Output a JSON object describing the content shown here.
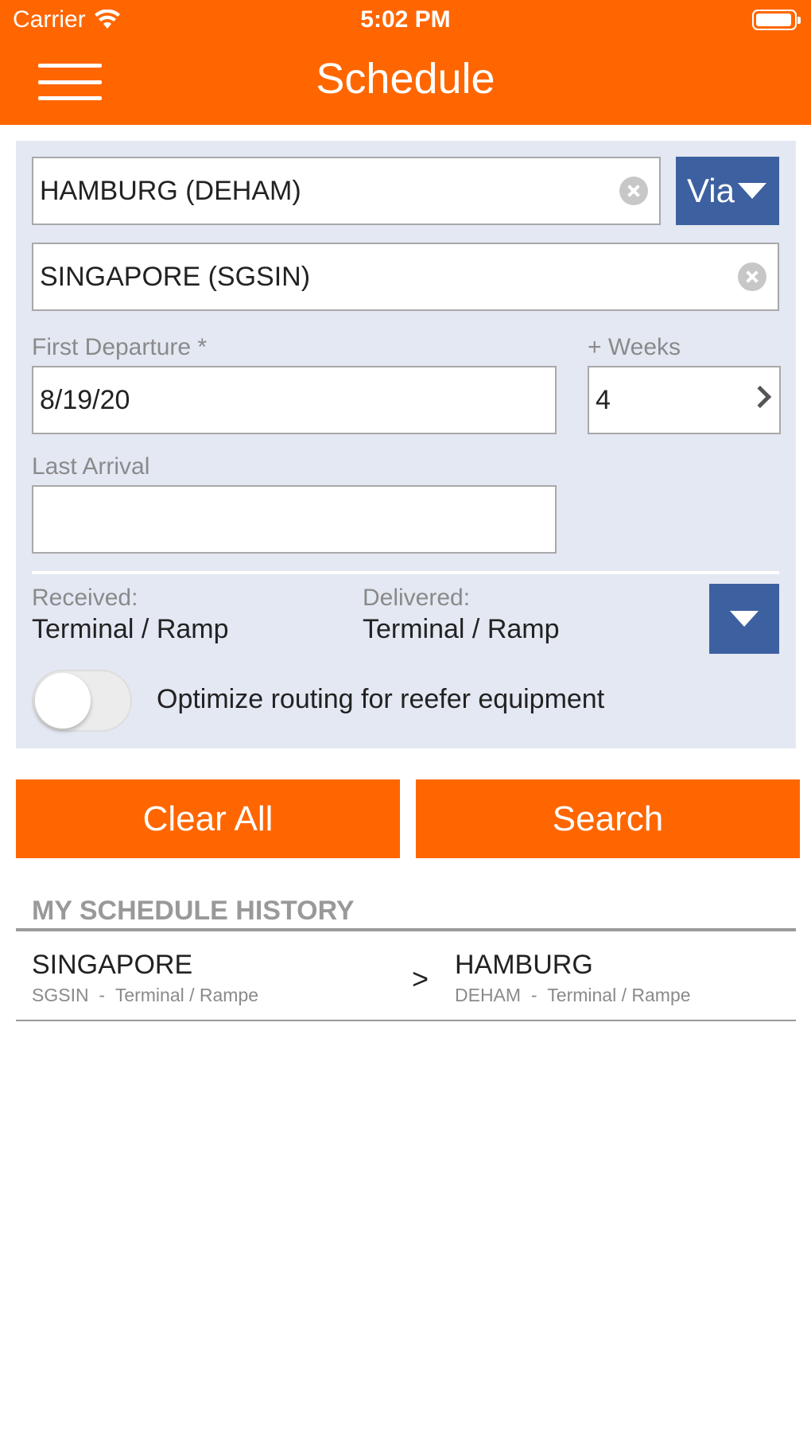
{
  "status_bar": {
    "carrier": "Carrier",
    "time": "5:02 PM"
  },
  "nav": {
    "title": "Schedule",
    "menu_icon": "hamburger-menu-icon"
  },
  "form": {
    "origin_value": "HAMBURG (DEHAM)",
    "via_label": "Via",
    "destination_value": "SINGAPORE (SGSIN)",
    "first_departure_label": "First Departure *",
    "first_departure_value": "8/19/20",
    "weeks_label": "+ Weeks",
    "weeks_value": "4",
    "last_arrival_label": "Last Arrival",
    "last_arrival_value": "",
    "received_label": "Received:",
    "received_value": "Terminal / Ramp",
    "delivered_label": "Delivered:",
    "delivered_value": "Terminal / Ramp",
    "reefer_toggle_label": "Optimize routing for reefer equipment",
    "reefer_toggle_on": false
  },
  "actions": {
    "clear_all": "Clear All",
    "search": "Search"
  },
  "history": {
    "title": "MY SCHEDULE HISTORY",
    "items": [
      {
        "from_city": "SINGAPORE",
        "from_code": "SGSIN",
        "from_sep": "-",
        "from_type": "Terminal / Rampe",
        "arrow": ">",
        "to_city": "HAMBURG",
        "to_code": "DEHAM",
        "to_sep": "-",
        "to_type": "Terminal / Rampe"
      }
    ]
  },
  "colors": {
    "brand_orange": "#ff6600",
    "accent_blue": "#3d60a0",
    "panel_bg": "#e3e8f3"
  }
}
